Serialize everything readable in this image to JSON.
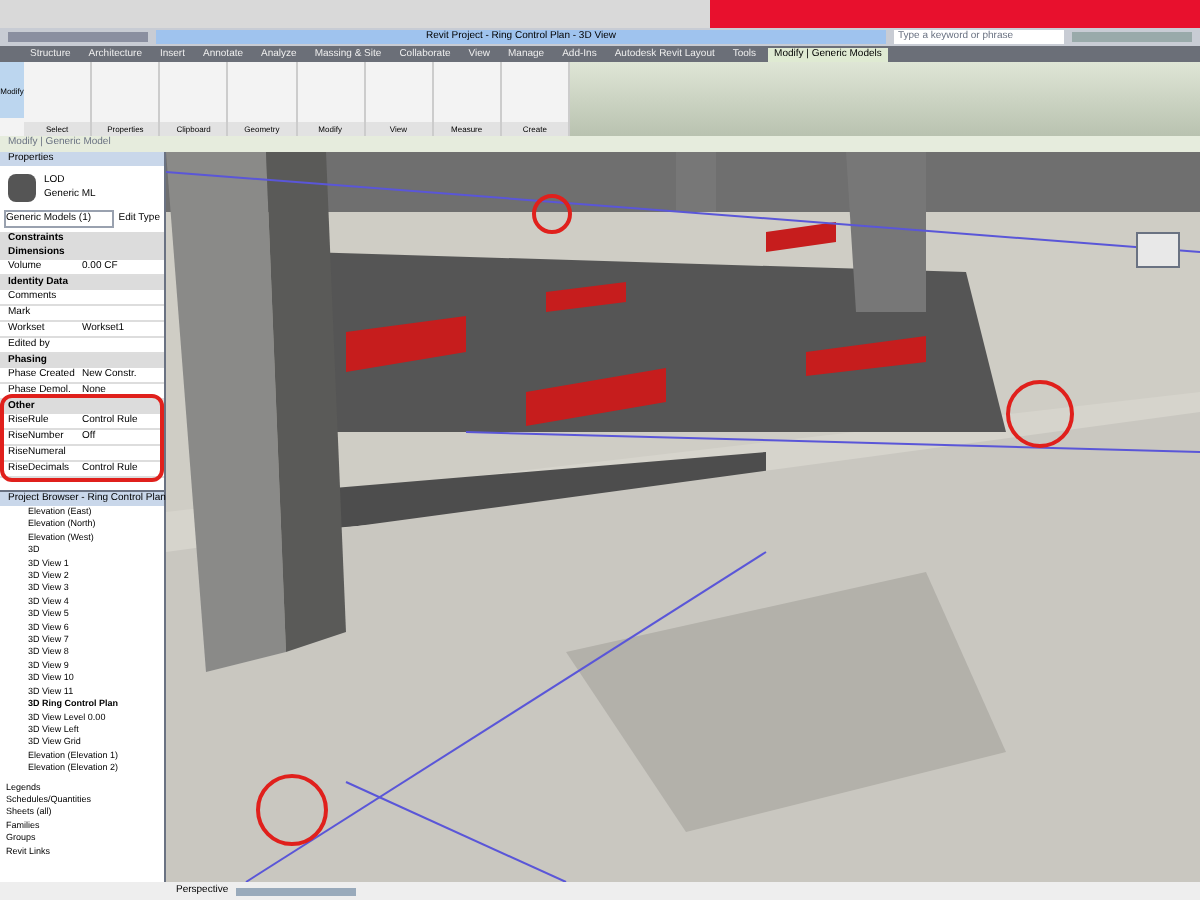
{
  "title_bar": {
    "title": "Revit Project - Ring Control Plan - 3D View"
  },
  "search": {
    "placeholder": "Type a keyword or phrase"
  },
  "ribbon_tabs": [
    {
      "label": "Structure",
      "selected": false
    },
    {
      "label": "Architecture",
      "selected": false
    },
    {
      "label": "Insert",
      "selected": false
    },
    {
      "label": "Annotate",
      "selected": false
    },
    {
      "label": "Analyze",
      "selected": false
    },
    {
      "label": "Massing & Site",
      "selected": false
    },
    {
      "label": "Collaborate",
      "selected": false
    },
    {
      "label": "View",
      "selected": false
    },
    {
      "label": "Manage",
      "selected": false
    },
    {
      "label": "Add-Ins",
      "selected": false
    },
    {
      "label": "Autodesk Revit Layout",
      "selected": false
    },
    {
      "label": "Tools",
      "selected": false
    },
    {
      "label": "Modify | Generic Models",
      "selected": true
    }
  ],
  "ribbon_panels": [
    "Select",
    "Properties",
    "Clipboard",
    "Geometry",
    "Modify",
    "View",
    "Measure",
    "Create"
  ],
  "modify_button": "Modify",
  "options_bar": "Modify | Generic Model",
  "properties": {
    "title": "Properties",
    "type_name": "LOD",
    "type_sub": "Generic ML",
    "selector": "Generic Models (1)",
    "edit_type": "Edit Type",
    "rows": [
      {
        "kind": "section",
        "label": "Constraints"
      },
      {
        "kind": "section",
        "label": "Dimensions"
      },
      {
        "kind": "field",
        "label": "Volume",
        "value": "0.00 CF"
      },
      {
        "kind": "section",
        "label": "Identity Data"
      },
      {
        "kind": "field",
        "label": "Comments",
        "value": ""
      },
      {
        "kind": "field",
        "label": "Mark",
        "value": ""
      },
      {
        "kind": "field",
        "label": "Workset",
        "value": "Workset1"
      },
      {
        "kind": "field",
        "label": "Edited by",
        "value": ""
      },
      {
        "kind": "section",
        "label": "Phasing"
      },
      {
        "kind": "field",
        "label": "Phase Created",
        "value": "New Constr."
      },
      {
        "kind": "field",
        "label": "Phase Demol.",
        "value": "None"
      },
      {
        "kind": "section",
        "label": "Other"
      },
      {
        "kind": "field",
        "label": "RiseRule",
        "value": "Control Rule"
      },
      {
        "kind": "field",
        "label": "RiseNumber",
        "value": "Off"
      },
      {
        "kind": "field",
        "label": "RiseNumeral",
        "value": ""
      },
      {
        "kind": "field",
        "label": "RiseDecimals",
        "value": "Control Rule"
      }
    ]
  },
  "browser": {
    "title": "Project Browser - Ring Control Plan",
    "items": [
      {
        "label": "Elevation (East)",
        "bold": false
      },
      {
        "label": "Elevation (North)",
        "bold": false
      },
      {
        "label": "Elevation (West)",
        "bold": false
      },
      {
        "label": "3D",
        "bold": false
      },
      {
        "label": "3D View 1",
        "bold": false
      },
      {
        "label": "3D View 2",
        "bold": false
      },
      {
        "label": "3D View 3",
        "bold": false
      },
      {
        "label": "3D View 4",
        "bold": false
      },
      {
        "label": "3D View 5",
        "bold": false
      },
      {
        "label": "3D View 6",
        "bold": false
      },
      {
        "label": "3D View 7",
        "bold": false
      },
      {
        "label": "3D View 8",
        "bold": false
      },
      {
        "label": "3D View 9",
        "bold": false
      },
      {
        "label": "3D View 10",
        "bold": false
      },
      {
        "label": "3D View 11",
        "bold": false
      },
      {
        "label": "3D Ring Control Plan",
        "bold": true
      },
      {
        "label": "3D View Level 0.00",
        "bold": false
      },
      {
        "label": "3D View Left",
        "bold": false
      },
      {
        "label": "3D View Grid",
        "bold": false
      },
      {
        "label": "Elevation (Elevation 1)",
        "bold": false
      },
      {
        "label": "Elevation (Elevation 2)",
        "bold": false
      }
    ],
    "groups": [
      "Legends",
      "Schedules/Quantities",
      "Sheets (all)",
      "Families",
      "Groups",
      "Revit Links"
    ]
  },
  "status_bar": {
    "view": "Perspective"
  }
}
